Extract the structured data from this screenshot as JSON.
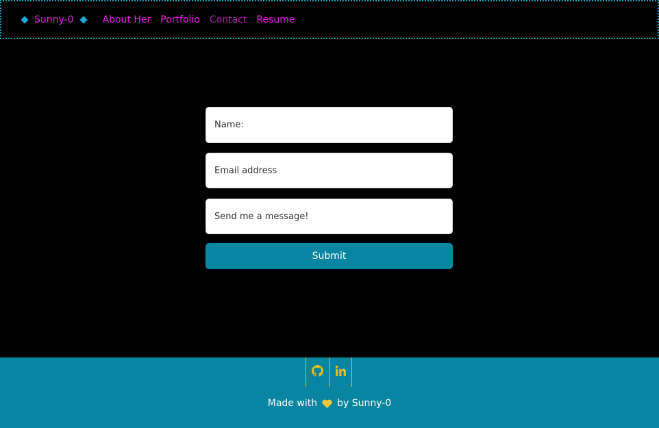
{
  "nav": {
    "brand": "Sunny-0",
    "links": [
      "About Her",
      "Portfolio",
      "Contact",
      "Resume"
    ]
  },
  "form": {
    "name_placeholder": "Name:",
    "email_placeholder": "Email address",
    "message_placeholder": "Send me a message!",
    "submit_label": "Submit"
  },
  "footer": {
    "social_icons": [
      "github-icon",
      "linkedin-icon"
    ],
    "made_with": "Made with",
    "by": "by Sunny-0"
  },
  "colors": {
    "accent": "#e81ce8",
    "teal": "#0885a0",
    "gold": "#e6c01a",
    "background": "#000000"
  }
}
